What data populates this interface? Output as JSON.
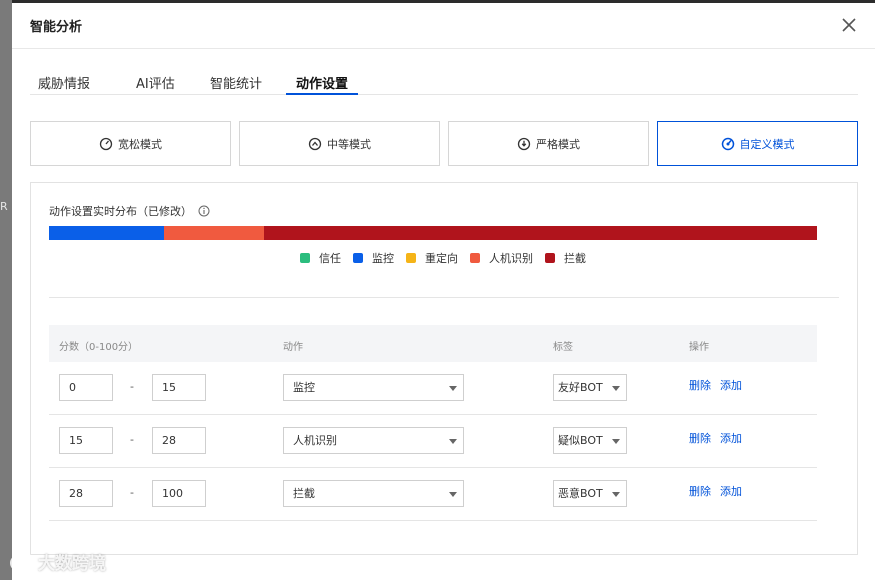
{
  "dialog": {
    "title": "智能分析"
  },
  "tabs": [
    {
      "label": "威胁情报"
    },
    {
      "label": "AI评估"
    },
    {
      "label": "智能统计"
    },
    {
      "label": "动作设置"
    }
  ],
  "modes": [
    {
      "label": "宽松模式",
      "icon": "gauge-low-icon"
    },
    {
      "label": "中等模式",
      "icon": "gauge-mid-icon"
    },
    {
      "label": "严格模式",
      "icon": "gauge-high-icon"
    },
    {
      "label": "自定义模式",
      "icon": "gauge-custom-icon"
    }
  ],
  "panel": {
    "title": "动作设置实时分布（已修改）",
    "distribution": [
      {
        "action": "监控",
        "fraction": 0.15,
        "color": "#0a5fe8"
      },
      {
        "action": "人机识别",
        "fraction": 0.13,
        "color": "#f05a3f"
      },
      {
        "action": "拦截",
        "fraction": 0.72,
        "color": "#b0141c"
      }
    ],
    "legend": [
      {
        "label": "信任",
        "color": "#2bbd7e"
      },
      {
        "label": "监控",
        "color": "#0a5fe8"
      },
      {
        "label": "重定向",
        "color": "#f5b418"
      },
      {
        "label": "人机识别",
        "color": "#f05a3f"
      },
      {
        "label": "拦截",
        "color": "#b0141c"
      }
    ]
  },
  "table": {
    "headers": {
      "score": "分数（0-100分）",
      "action": "动作",
      "tag": "标签",
      "op": "操作"
    },
    "separator": "-",
    "rows": [
      {
        "min": "0",
        "max": "15",
        "action": "监控",
        "tag": "友好BOT",
        "delete": "删除",
        "add": "添加"
      },
      {
        "min": "15",
        "max": "28",
        "action": "人机识别",
        "tag": "疑似BOT",
        "delete": "删除",
        "add": "添加"
      },
      {
        "min": "28",
        "max": "100",
        "action": "拦截",
        "tag": "恶意BOT",
        "delete": "删除",
        "add": "添加"
      }
    ]
  },
  "background": {
    "strip_text": "R"
  },
  "watermark": {
    "text": "大数跨境"
  }
}
